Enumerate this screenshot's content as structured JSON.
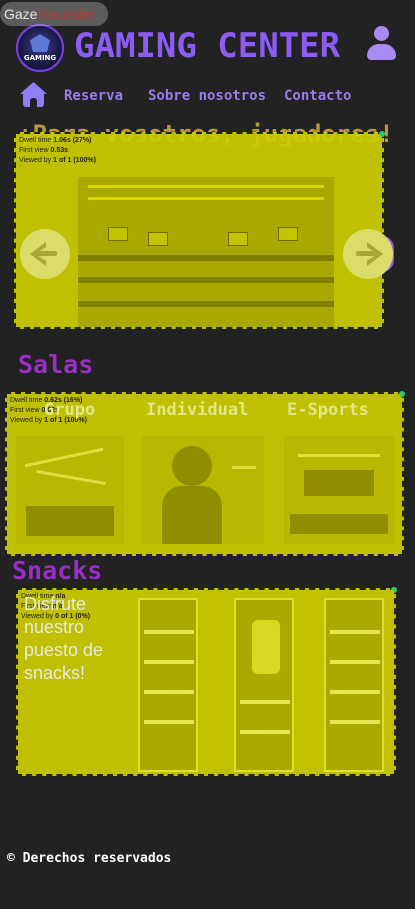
{
  "recorder": {
    "part1": "Gaze",
    "part2": "Recorder"
  },
  "header": {
    "logo_text": "GAMING",
    "title": "GAMING CENTER"
  },
  "nav": {
    "items": [
      "Reserva",
      "Sobre nosotros",
      "Contacto"
    ]
  },
  "hero": {
    "heading": "¡Para vosotros, jugadores!",
    "gaze": {
      "dwell_label": "Dwell time",
      "dwell_value": "1.06s (27%)",
      "first_label": "First view",
      "first_value": "0.53s",
      "viewed_label": "Viewed by",
      "viewed_value": "1 of 1 (100%)"
    }
  },
  "salas": {
    "title": "Salas",
    "labels": [
      "Grupo",
      "Individual",
      "E-Sports"
    ],
    "gaze": {
      "dwell_label": "Dwell time",
      "dwell_value": "0.62s (16%)",
      "first_label": "First view",
      "first_value": "0.02s",
      "viewed_label": "Viewed by",
      "viewed_value": "1 of 1 (100%)"
    }
  },
  "snacks": {
    "title": "Snacks",
    "text": "Disfrute nuestro puesto de snacks!",
    "gaze": {
      "dwell_label": "Dwell time",
      "dwell_value": "n/a",
      "first_label": "First view",
      "first_value": "n/a",
      "viewed_label": "Viewed by",
      "viewed_value": "0 of 1 (0%)"
    }
  },
  "footer": {
    "text": "© Derechos reservados"
  },
  "colors": {
    "accent": "#8c5cf5",
    "section_title": "#9b2ec7",
    "gaze_overlay": "#cccc00",
    "background": "#222222"
  },
  "icons": [
    "user-icon",
    "home-icon",
    "arrow-left-icon",
    "arrow-right-icon"
  ]
}
